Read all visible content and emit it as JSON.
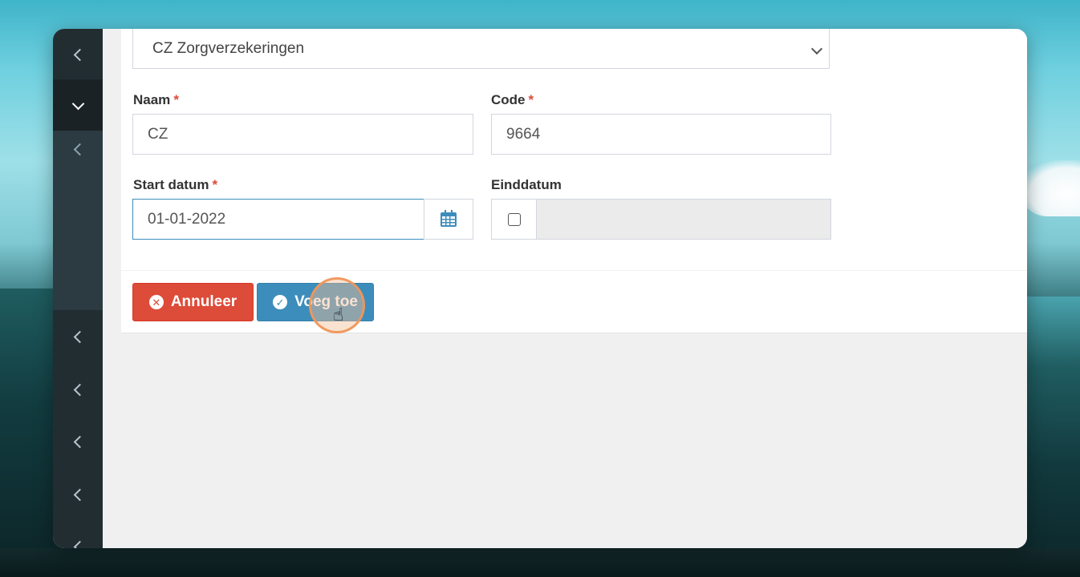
{
  "form": {
    "insurer_select_value": "CZ Zorgverzekeringen",
    "naam_label": "Naam",
    "naam_value": "CZ",
    "code_label": "Code",
    "code_value": "9664",
    "start_label": "Start datum",
    "start_value": "01-01-2022",
    "eind_label": "Einddatum",
    "eind_value": "",
    "required_mark": "*"
  },
  "buttons": {
    "cancel_label": "Annuleer",
    "add_label": "Voeg toe"
  },
  "icons": {
    "cancel": "times-circle-icon",
    "add": "check-circle-icon",
    "calendar": "calendar-icon",
    "pointer": "hand-pointer-icon"
  },
  "colors": {
    "danger": "#dd4b39",
    "primary": "#3c8dbc",
    "sidebar": "#222d32"
  }
}
